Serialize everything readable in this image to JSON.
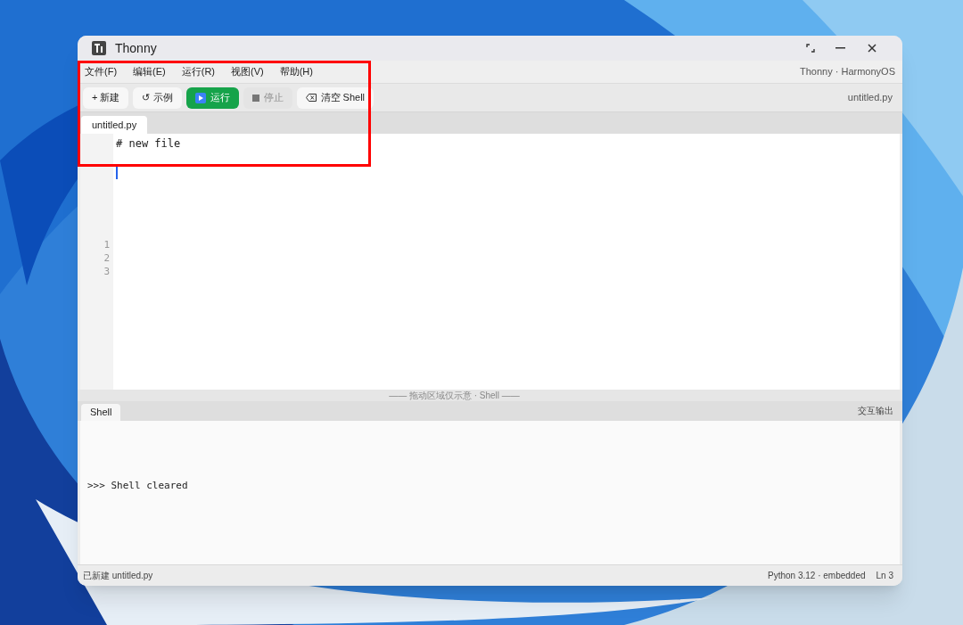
{
  "window": {
    "title": "Thonny"
  },
  "menu": [
    {
      "label": "文件(F)"
    },
    {
      "label": "编辑(E)"
    },
    {
      "label": "运行(R)"
    },
    {
      "label": "视图(V)"
    },
    {
      "label": "帮助(H)"
    }
  ],
  "menu_right": "Thonny · HarmonyOS",
  "toolbar": [
    {
      "kind": "new",
      "label": "+ 新建",
      "disabled": false
    },
    {
      "kind": "example",
      "label": "↺ 示例",
      "disabled": false
    },
    {
      "kind": "run",
      "label": "运行",
      "disabled": false
    },
    {
      "kind": "stop",
      "label": "停止",
      "disabled": true
    },
    {
      "kind": "clear",
      "label": "清空 Shell",
      "disabled": false
    }
  ],
  "toolbar_right": "untitled.py",
  "editor_tabs": [
    {
      "label": "untitled.py",
      "selected": true
    }
  ],
  "editor": {
    "code_lines": [
      "# new file"
    ],
    "line_numbers": [
      "1",
      "2",
      "3"
    ]
  },
  "divider_label": "—— 拖动区域仅示意 · Shell ——",
  "shell_tabs": [
    {
      "label": "Shell",
      "selected": true
    }
  ],
  "shell_right": "交互输出",
  "shell_lines": [
    ">>> Shell cleared"
  ],
  "status_bar": {
    "left": "已新建 untitled.py",
    "right": "Python 3.12 · embedded",
    "position": "Ln 3"
  }
}
